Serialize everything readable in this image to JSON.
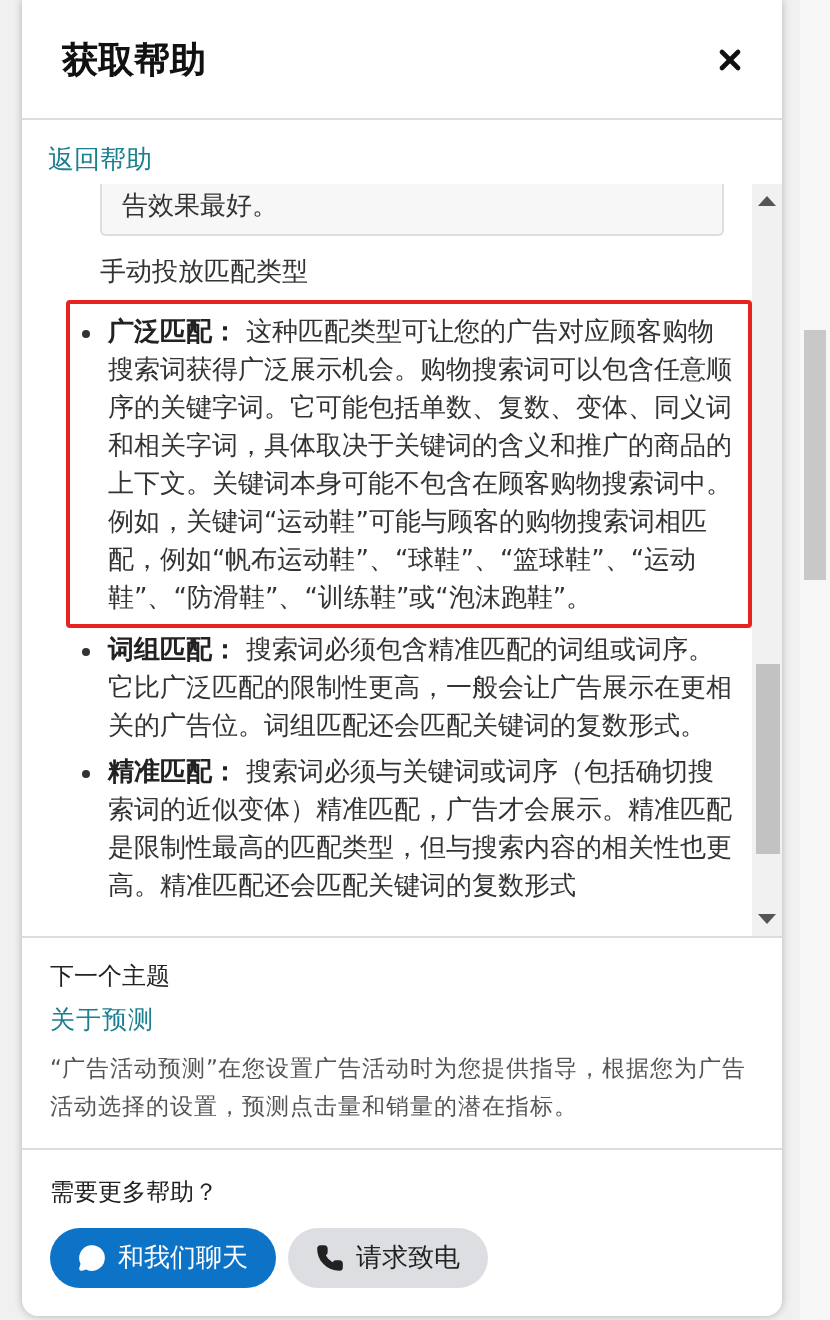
{
  "header": {
    "title": "获取帮助"
  },
  "back_link": "返回帮助",
  "article": {
    "quote": "告效果最好。",
    "heading": "手动投放匹配类型",
    "bullets": [
      {
        "text": "**广泛匹配：** 这种匹配类型可让您的广告对应顾客购物搜索词获得广泛展示机会。购物搜索词可以包含任意顺序的关键字词。它可能包括单数、复数、变体、同义词和相关字词，具体取决于关键词的含义和推广的商品的上下文。关键词本身可能不包含在顾客购物搜索词中。例如，关键词“运动鞋”可能与顾客的购物搜索词相匹配，例如“帆布运动鞋”、“球鞋”、“篮球鞋”、“运动鞋”、“防滑鞋”、“训练鞋”或“泡沫跑鞋”。",
        "highlighted": true
      },
      {
        "text": "**词组匹配：** 搜索词必须包含精准匹配的词组或词序。它比广泛匹配的限制性更高，一般会让广告展示在更相关的广告位。词组匹配还会匹配关键词的复数形式。",
        "highlighted": false
      },
      {
        "text": "**精准匹配：** 搜索词必须与关键词或词序（包括确切搜索词的近似变体）精准匹配，广告才会展示。精准匹配是限制性最高的匹配类型，但与搜索内容的相关性也更高。精准匹配还会匹配关键词的复数形式",
        "highlighted": false
      }
    ]
  },
  "next_topic": {
    "label": "下一个主题",
    "link": "关于预测",
    "description": "“广告活动预测”在您设置广告活动时为您提供指导，根据您为广告活动选择的设置，预测点击量和销量的潜在指标。"
  },
  "more_help": {
    "label": "需要更多帮助？",
    "buttons": [
      {
        "label": "和我们聊天",
        "kind": "chat"
      },
      {
        "label": "请求致电",
        "kind": "call"
      }
    ]
  }
}
